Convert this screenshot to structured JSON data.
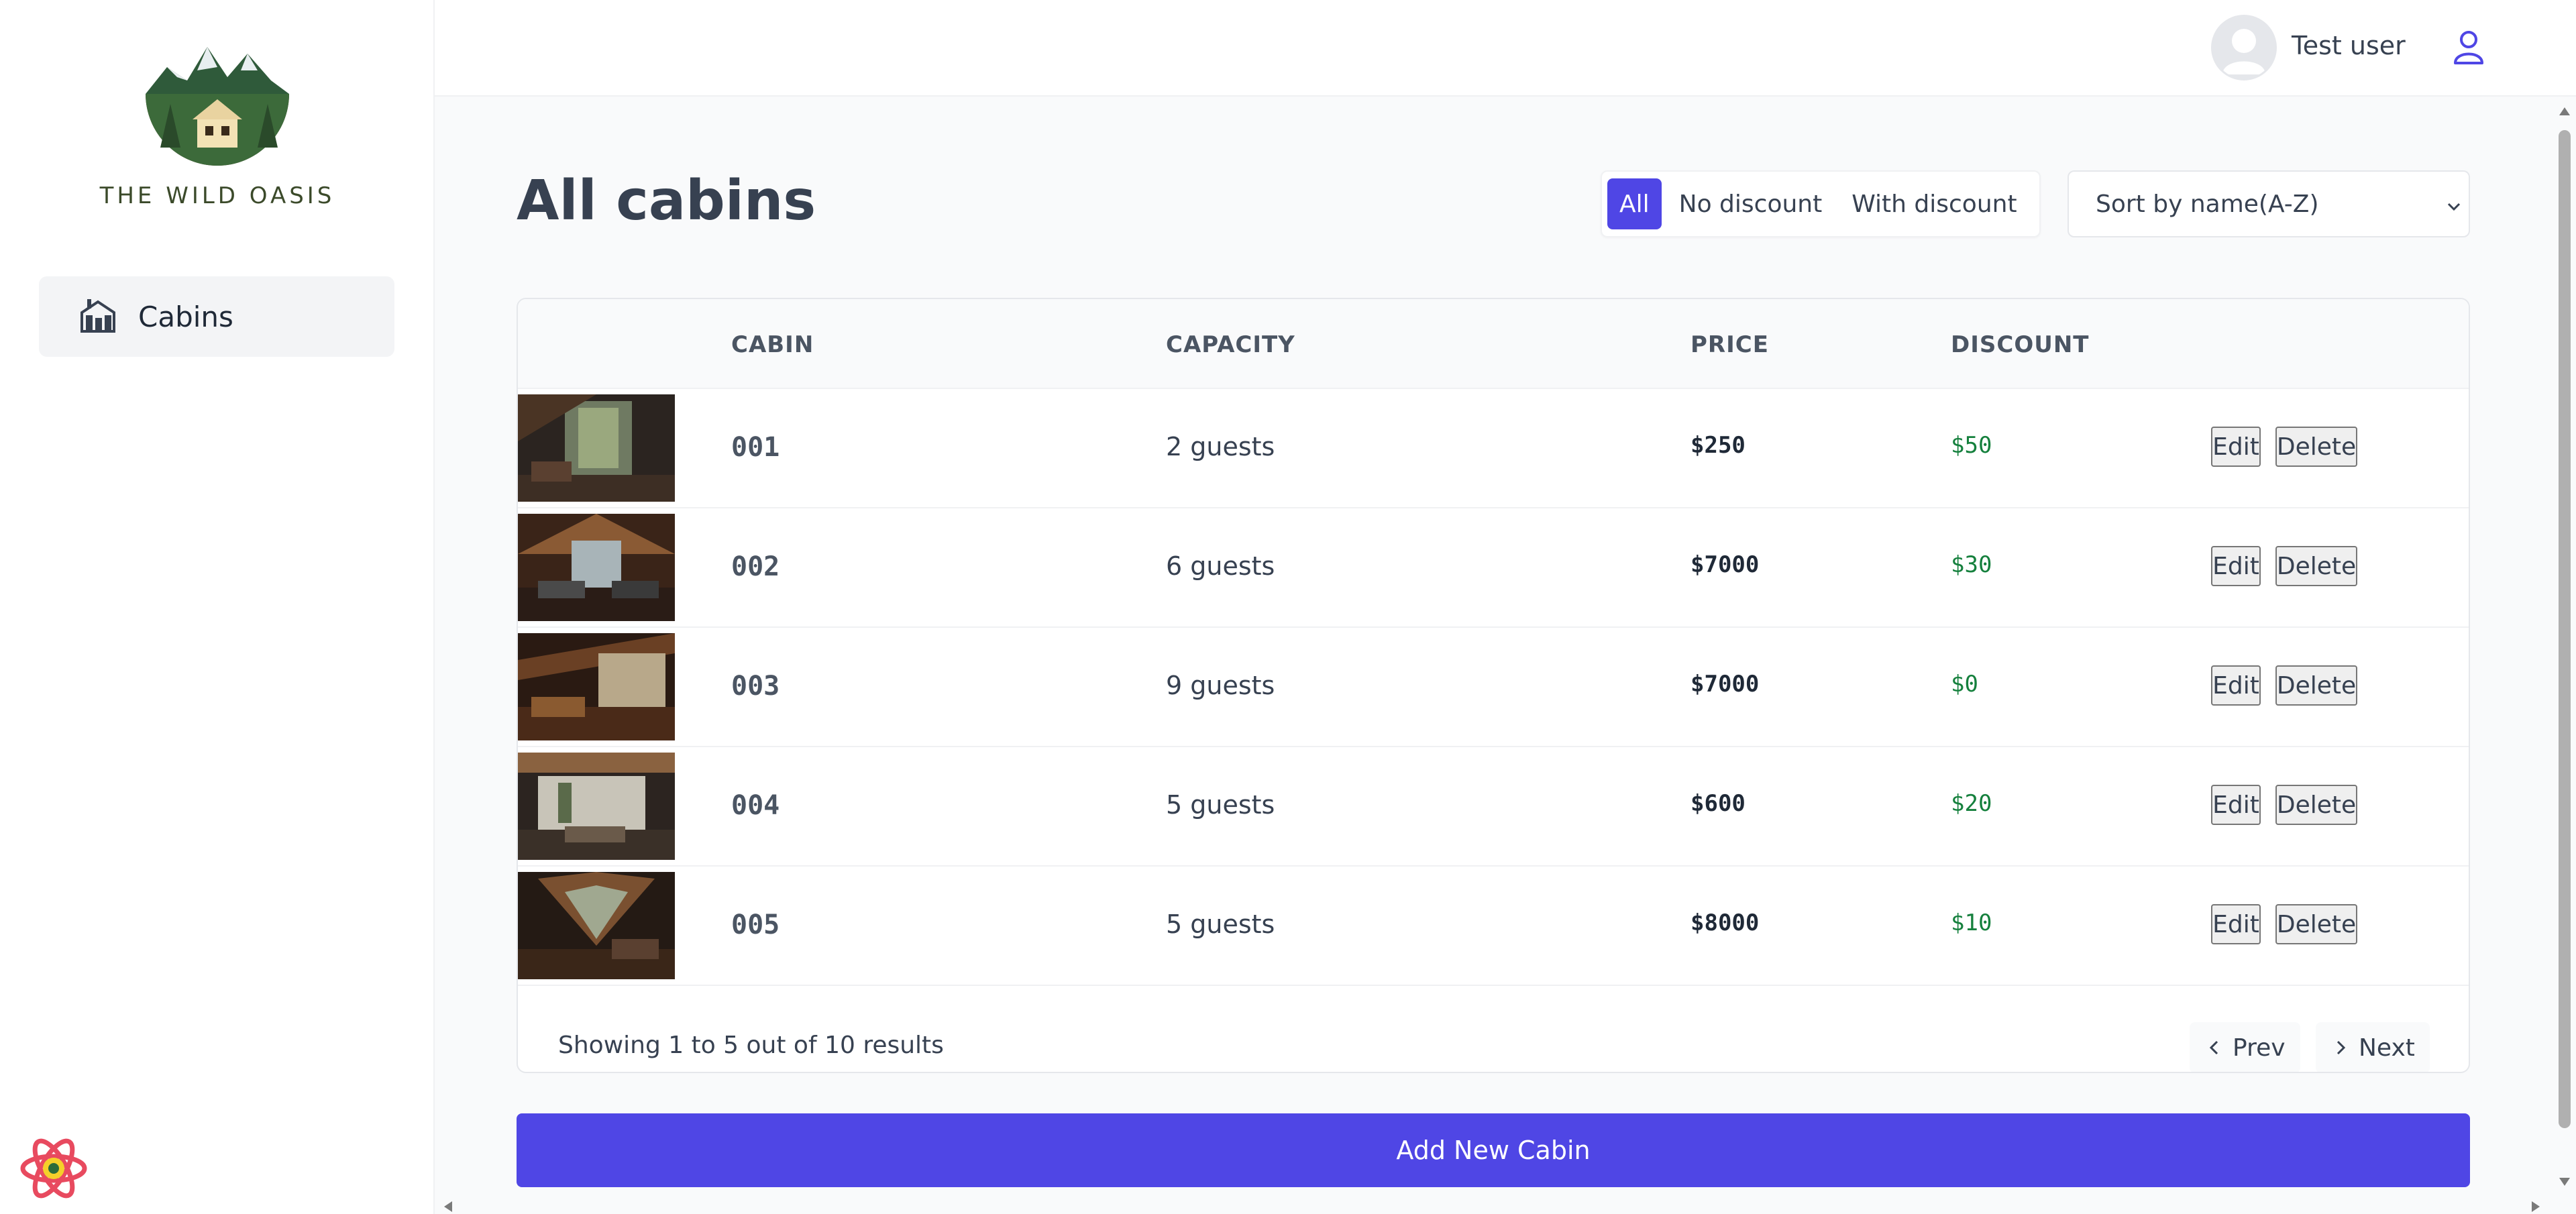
{
  "sidebar": {
    "logo_text": "THE WILD OASIS",
    "items": [
      {
        "label": "Cabins",
        "icon": "home-icon"
      }
    ]
  },
  "header": {
    "username": "Test user"
  },
  "page": {
    "title": "All cabins",
    "filters": [
      {
        "label": "All",
        "active": true
      },
      {
        "label": "No discount",
        "active": false
      },
      {
        "label": "With discount",
        "active": false
      }
    ],
    "sort": {
      "selected": "Sort by name(A-Z)"
    }
  },
  "table": {
    "headers": [
      "CABIN",
      "CAPACITY",
      "PRICE",
      "DISCOUNT"
    ],
    "rows": [
      {
        "cabin": "001",
        "capacity": "2 guests",
        "price": "$250",
        "discount": "$50"
      },
      {
        "cabin": "002",
        "capacity": "6 guests",
        "price": "$7000",
        "discount": "$30"
      },
      {
        "cabin": "003",
        "capacity": "9 guests",
        "price": "$7000",
        "discount": "$0"
      },
      {
        "cabin": "004",
        "capacity": "5 guests",
        "price": "$600",
        "discount": "$20"
      },
      {
        "cabin": "005",
        "capacity": "5 guests",
        "price": "$8000",
        "discount": "$10"
      }
    ],
    "edit_label": "Edit",
    "delete_label": "Delete",
    "footer": {
      "summary": "Showing 1 to 5 out of 10 results",
      "prev_label": "Prev",
      "next_label": "Next"
    }
  },
  "actions": {
    "add_label": "Add New Cabin"
  },
  "colors": {
    "accent": "#4f46e5",
    "discount": "#15803d"
  }
}
